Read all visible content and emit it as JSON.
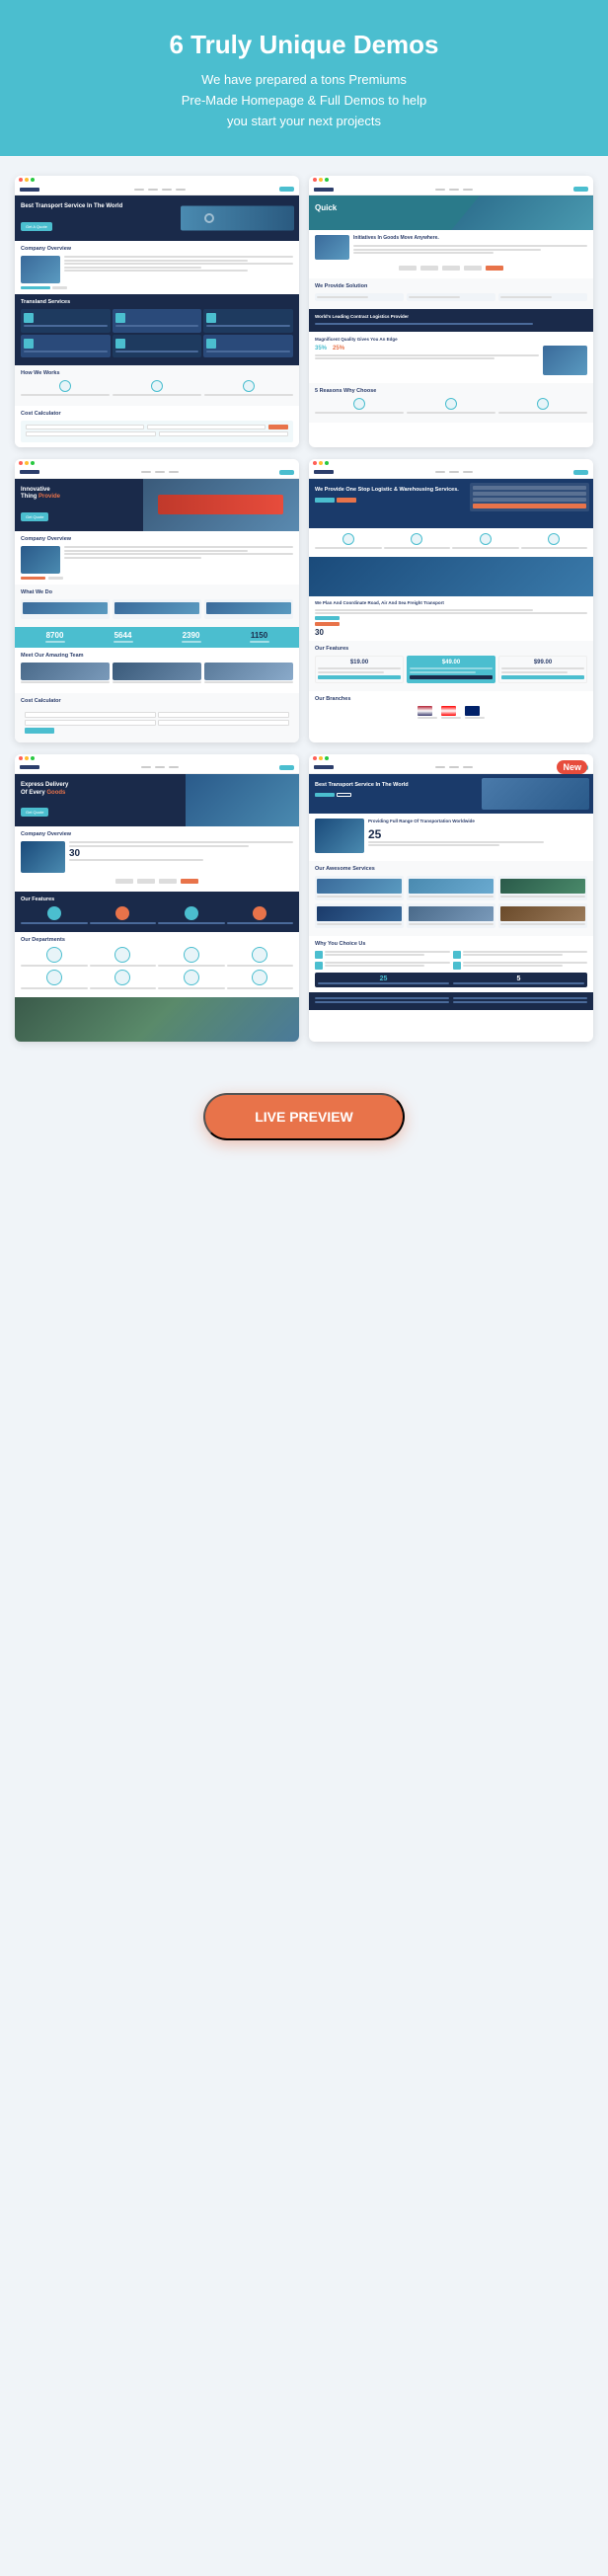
{
  "header": {
    "title": "6 Truly Unique Demos",
    "subtitle": "We have prepared a tons Premiums\nPre-Made Homepage & Full Demos to help\nyou start your next projects"
  },
  "demos": [
    {
      "id": "demo1",
      "hero_title": "Best Transport Service In The World",
      "hero_cta": "Get A Quote",
      "section1": "Company Overview",
      "section2": "Transland Services",
      "section3": "How We Works",
      "section4": "Cost Calculator"
    },
    {
      "id": "demo2",
      "label": "Quick",
      "section1": "Initiatives In Goods Move Anywhere.",
      "section2": "We Provide Solution",
      "section3": "World's Leading Contract Logistics Provider",
      "section4": "Magnificent Quality Gives You An Edge",
      "stats": "35%  25%",
      "section5": "5 Reasons Why Choose"
    },
    {
      "id": "demo3",
      "hero_title": "Innovative Thing Provide",
      "section1": "Company Overview",
      "section2": "What We Do",
      "stats": "8700   5644   2390   1150",
      "section3": "Meet Our Amazing Team",
      "section4": "Cost Calculator"
    },
    {
      "id": "demo4",
      "hero_title": "We Provide One Stop Logistic & Warehousing Services.",
      "section1": "We Plan And Coordinate Road, Air And Sea Freight Transport",
      "section2": "Our Features",
      "pricing": [
        "$19.00",
        "$49.00",
        "$99.00"
      ],
      "section3": "Our Branches",
      "branches": [
        "America / Los Angeles",
        "Canada / Hamilton",
        "Great Britain"
      ]
    },
    {
      "id": "demo5",
      "hero_title": "Express Delivery Of Every Goods",
      "section1": "Company Overview",
      "stat1": "30",
      "section2": "Our Features",
      "section3": "Our Departments"
    },
    {
      "id": "demo6",
      "is_new": true,
      "hero_title": "Best Transport Service In The World",
      "section1": "Providing Full Range Of Transportation Worldwide",
      "stat1": "25",
      "section2": "Our Awesome Services",
      "services": [
        "Air Freight",
        "Buying Freight",
        "Ocean Freight",
        "Drone Freight",
        "Road Freight"
      ],
      "section3": "Why You Choice Us"
    }
  ],
  "live_preview": {
    "label": "LIVE PREVIEW"
  }
}
